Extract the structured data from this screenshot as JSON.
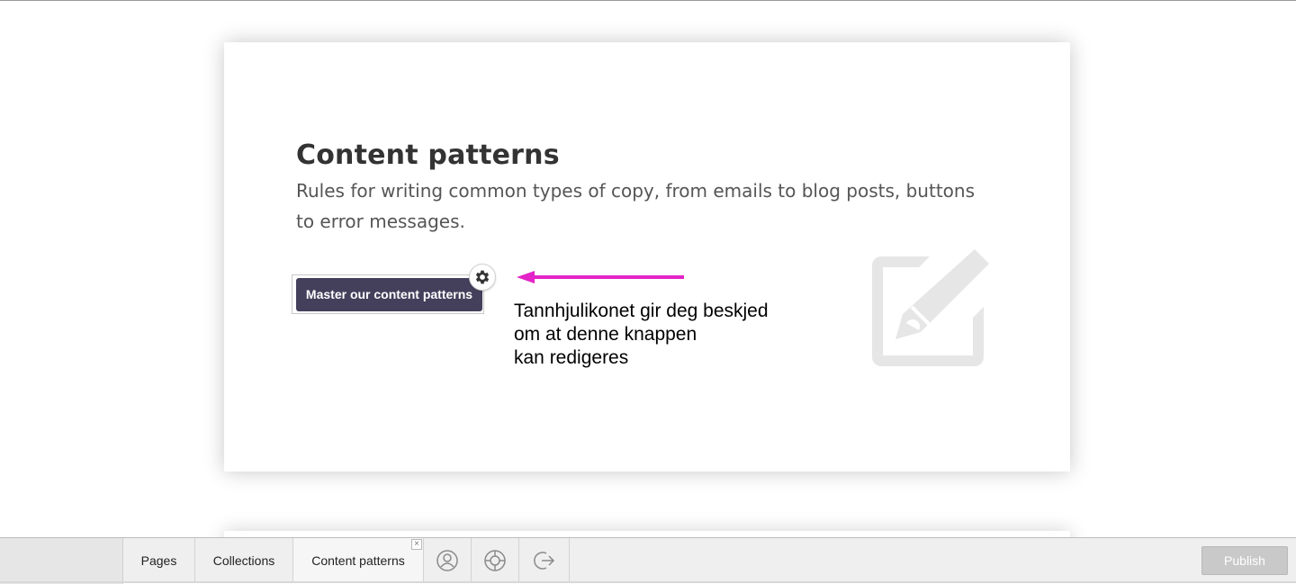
{
  "page": {
    "title": "Content patterns",
    "subtitle": "Rules for writing common types of copy, from emails to blog posts, buttons to error messages.",
    "cta_label": "Master our content patterns"
  },
  "annotation": {
    "lines": [
      "Tannhjulikonet gir deg beskjed",
      "om at denne knappen",
      "kan redigeres"
    ],
    "color": "#e324c8"
  },
  "bottombar": {
    "tabs": [
      {
        "label": "Pages"
      },
      {
        "label": "Collections"
      },
      {
        "label": "Content patterns",
        "closable": true,
        "close_glyph": "×"
      }
    ],
    "icons": [
      "user-icon",
      "help-lifebuoy-icon",
      "logout-icon"
    ],
    "publish_label": "Publish"
  },
  "colors": {
    "button_bg": "#44405c",
    "title": "#333333",
    "illustration": "#e6e6e6",
    "publish_bg": "#c9c9c9"
  }
}
